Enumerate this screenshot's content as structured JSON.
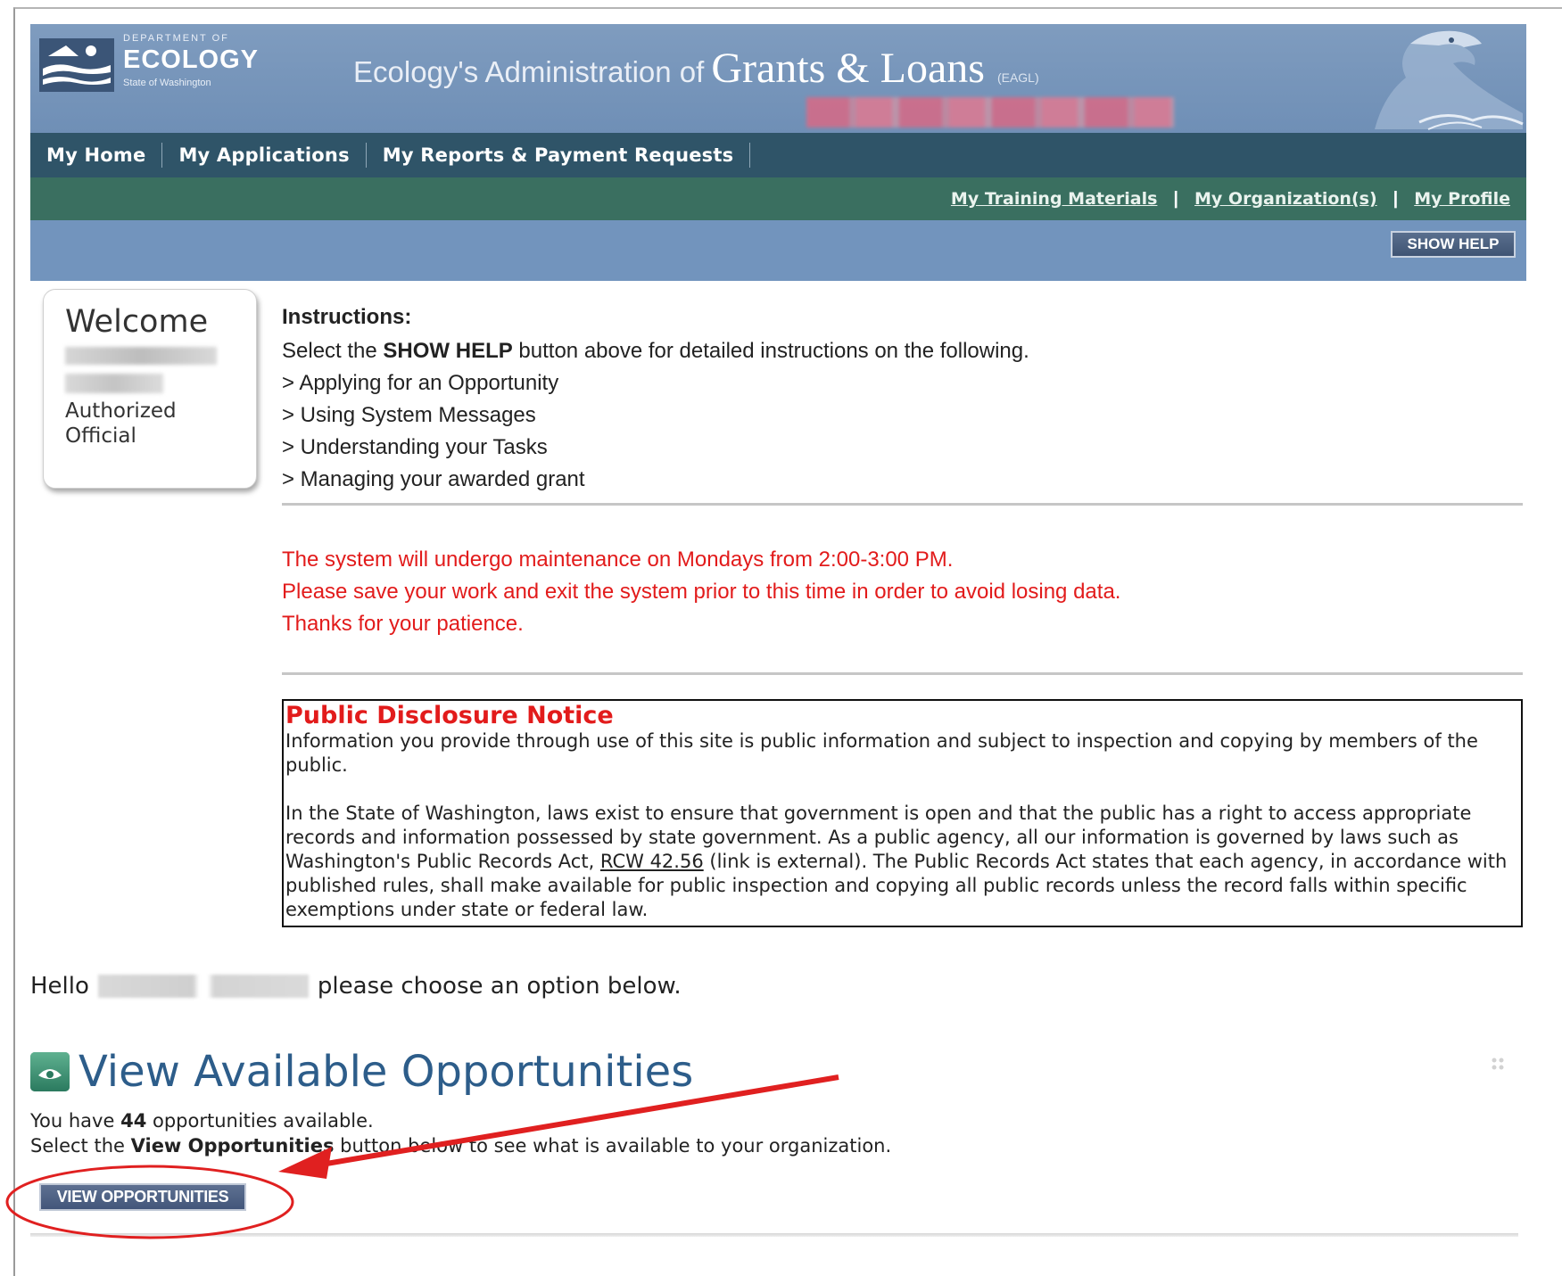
{
  "header": {
    "logo_dept": "DEPARTMENT OF",
    "logo_name": "ECOLOGY",
    "logo_state": "State of Washington",
    "title_prefix": "Ecology's Administration of",
    "title_main": "Grants & Loans",
    "title_abbr": "(EAGL)"
  },
  "nav": {
    "main": [
      "My Home",
      "My Applications",
      "My Reports & Payment Requests"
    ],
    "sub": [
      "My Training Materials",
      "My Organization(s)",
      "My Profile"
    ],
    "separator": "|",
    "show_help": "SHOW HELP"
  },
  "welcome": {
    "title": "Welcome",
    "role_line1": "Authorized",
    "role_line2": "Official"
  },
  "instructions": {
    "heading": "Instructions:",
    "intro_pre": "Select the ",
    "intro_bold": "SHOW HELP",
    "intro_post": " button above for detailed instructions on the following.",
    "items": [
      "> Applying for an Opportunity",
      "> Using System Messages",
      "> Understanding your Tasks",
      "> Managing your awarded grant"
    ]
  },
  "maintenance": [
    "The system will undergo maintenance on Mondays from 2:00-3:00 PM.",
    "Please save your work and exit the system prior to this time in order to avoid losing data.",
    "Thanks for your patience."
  ],
  "notice": {
    "title": "Public Disclosure Notice",
    "p1": "Information you provide through use of this site is public information and subject to inspection and copying by members of the public.",
    "p2_pre": "In the State of Washington, laws exist to ensure that government is open and that the public has a right to access appropriate records and information possessed by state government. As a public agency, all our information is governed by laws such as Washington's Public Records Act, ",
    "p2_link": "RCW 42.56",
    "p2_post": " (link is external). The Public Records Act states that each agency, in accordance with published rules, shall make available for public inspection and copying all public records unless the record falls within specific exemptions under state or federal law."
  },
  "hello": {
    "pre": "Hello",
    "post": "please choose an option below."
  },
  "opportunities": {
    "heading": "View Available Opportunities",
    "count_pre": "You have ",
    "count": "44",
    "count_post": " opportunities available.",
    "select_pre": "Select the ",
    "select_bold": "View Opportunities",
    "select_post": " button below to see what is available to your organization.",
    "button": "VIEW OPPORTUNITIES"
  },
  "colors": {
    "banner": "#7294bd",
    "nav_main": "#2f5468",
    "nav_sub": "#3a6f60",
    "alert_red": "#e21b1b",
    "heading_blue": "#2d5d8a",
    "annotation_red": "#e02020"
  },
  "icons": [
    "eagle-icon",
    "ecology-logo-icon",
    "opportunity-icon",
    "drag-handle-icon",
    "annotation-arrow",
    "annotation-circle"
  ]
}
